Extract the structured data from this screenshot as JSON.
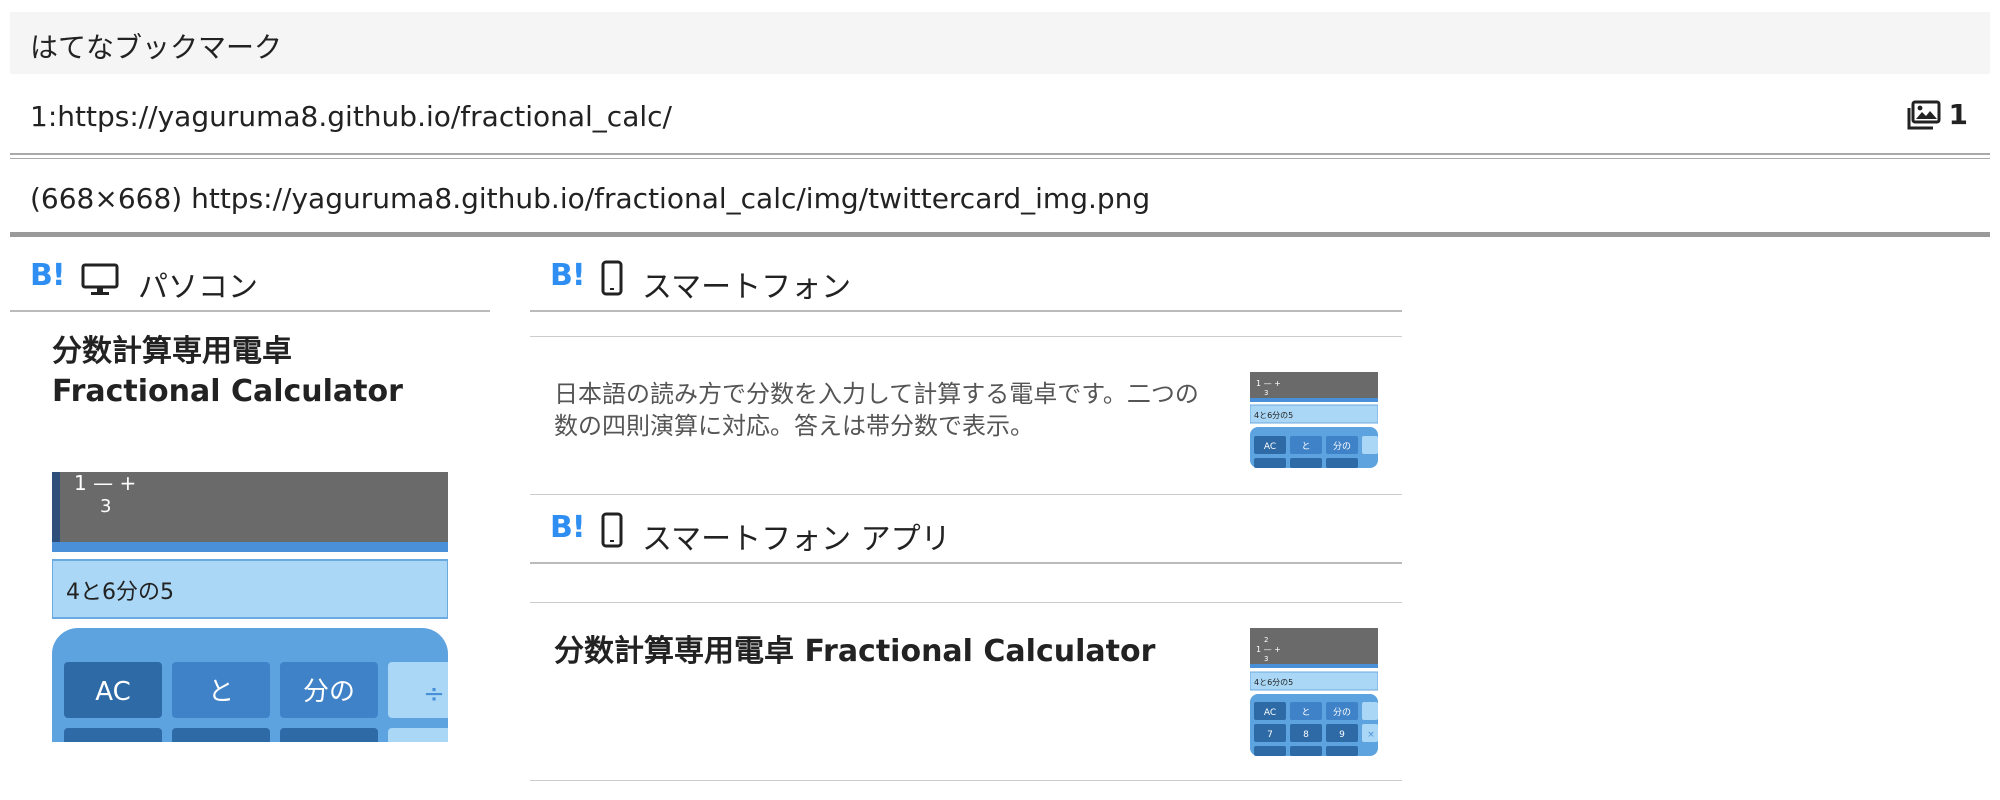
{
  "header": {
    "title": "はてなブックマーク"
  },
  "entry": {
    "url": "1:https://yaguruma8.github.io/fractional_calc/",
    "image_count": "1",
    "image_info": "(668×668) https://yaguruma8.github.io/fractional_calc/img/twittercard_img.png"
  },
  "pc": {
    "section_label": "パソコン",
    "bookmark_mark": "B!",
    "title_line1": "分数計算専用電卓",
    "title_line2": "Fractional Calculator"
  },
  "calc": {
    "display_top": "1 — +",
    "display_bottom": "3",
    "input_text": "4と6分の5",
    "keys": [
      "AC",
      "と",
      "分の",
      "÷"
    ],
    "small_keys_row2": [
      "7",
      "8",
      "9",
      "×"
    ]
  },
  "smartphone": {
    "section_label": "スマートフォン",
    "bookmark_mark": "B!",
    "description": "日本語の読み方で分数を入力して計算する電卓です。二つの数の四則演算に対応。答えは帯分数で表示。"
  },
  "smartphone_app": {
    "section_label": "スマートフォン アプリ",
    "bookmark_mark": "B!",
    "title": "分数計算専用電卓 Fractional Calculator"
  },
  "colors": {
    "bookmark_blue": "#2f8ef1",
    "calc_blue": "#4a90d9",
    "calc_dark": "#2d6aa6",
    "display_gray": "#656565"
  }
}
